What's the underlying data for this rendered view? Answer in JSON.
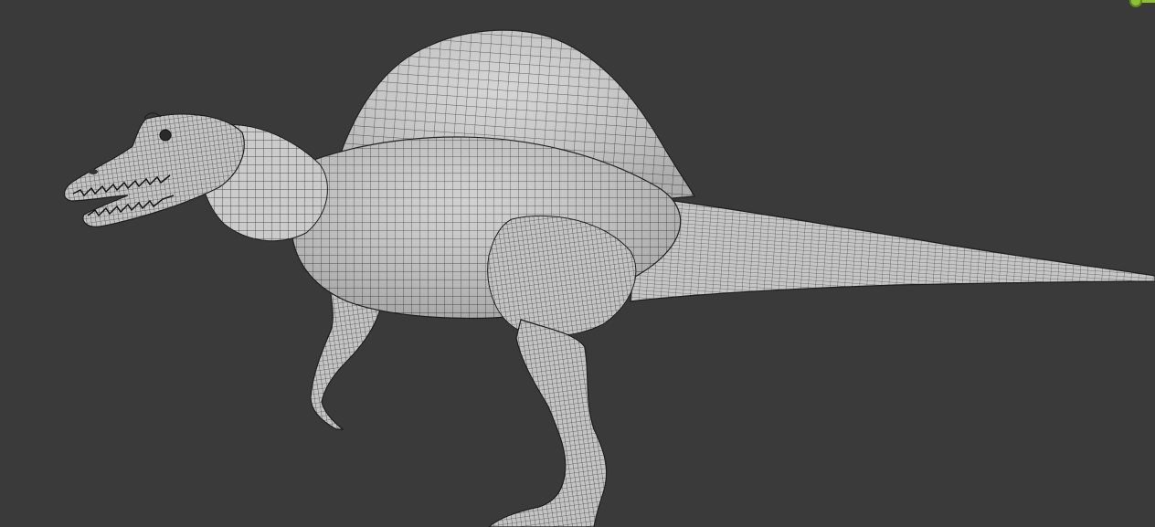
{
  "viewport": {
    "background": "#3a3a3a",
    "model": "wireframe-dinosaur-mesh",
    "shading": "solid-with-wireframe",
    "mesh_color": "#c9c9c9",
    "wire_color": "#1e1e1e"
  },
  "gizmo": {
    "icon": "origin-gizmo-icon",
    "color": "#8fbf3a"
  }
}
